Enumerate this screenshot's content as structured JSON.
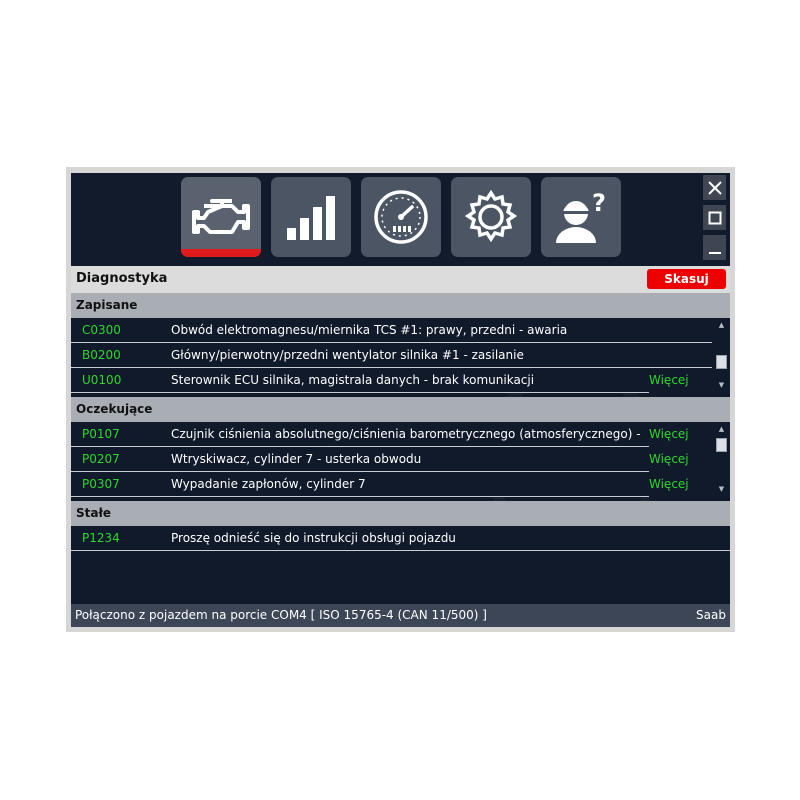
{
  "toolbar": {
    "buttons": [
      {
        "icon": "engine-icon",
        "active": true
      },
      {
        "icon": "signal-bars-icon",
        "active": false
      },
      {
        "icon": "gauge-icon",
        "active": false
      },
      {
        "icon": "gear-icon",
        "active": false
      },
      {
        "icon": "user-help-icon",
        "active": false
      }
    ],
    "window_controls": [
      "close-icon",
      "maximize-icon",
      "minimize-icon"
    ]
  },
  "title_bar": {
    "title": "Diagnostyka",
    "clear_label": "Skasuj"
  },
  "sections": {
    "stored": {
      "title": "Zapisane",
      "rows": [
        {
          "code": "C0300",
          "desc": "Obwód elektromagnesu/miernika TCS #1: prawy, przedni - awaria",
          "more": ""
        },
        {
          "code": "B0200",
          "desc": "Główny/pierwotny/przedni wentylator silnika #1 - zasilanie",
          "more": ""
        },
        {
          "code": "U0100",
          "desc": "Sterownik ECU silnika, magistrala danych - brak komunikacji",
          "more": "Więcej >>"
        }
      ]
    },
    "pending": {
      "title": "Oczekujące",
      "rows": [
        {
          "code": "P0107",
          "desc": "Czujnik ciśnienia absolutnego/ciśnienia barometrycznego (atmosferycznego) - sygnał wejściowy niski",
          "more": "Więcej >>"
        },
        {
          "code": "P0207",
          "desc": "Wtryskiwacz, cylinder 7 - usterka obwodu",
          "more": "Więcej >>"
        },
        {
          "code": "P0307",
          "desc": "Wypadanie zapłonów, cylinder 7",
          "more": "Więcej >>"
        }
      ]
    },
    "permanent": {
      "title": "Stałe",
      "rows": [
        {
          "code": "P1234",
          "desc": "Proszę odnieść się do instrukcji obsługi pojazdu",
          "more": ""
        }
      ]
    }
  },
  "status_bar": {
    "text": "Połączono z pojazdem na porcie COM4  [ ISO 15765-4 (CAN 11/500) ]",
    "brand": "Saab"
  },
  "colors": {
    "background": "#101a2b",
    "code_green": "#2fd62f",
    "accent_red": "#e11b1b",
    "button_gray": "#4b5563"
  }
}
